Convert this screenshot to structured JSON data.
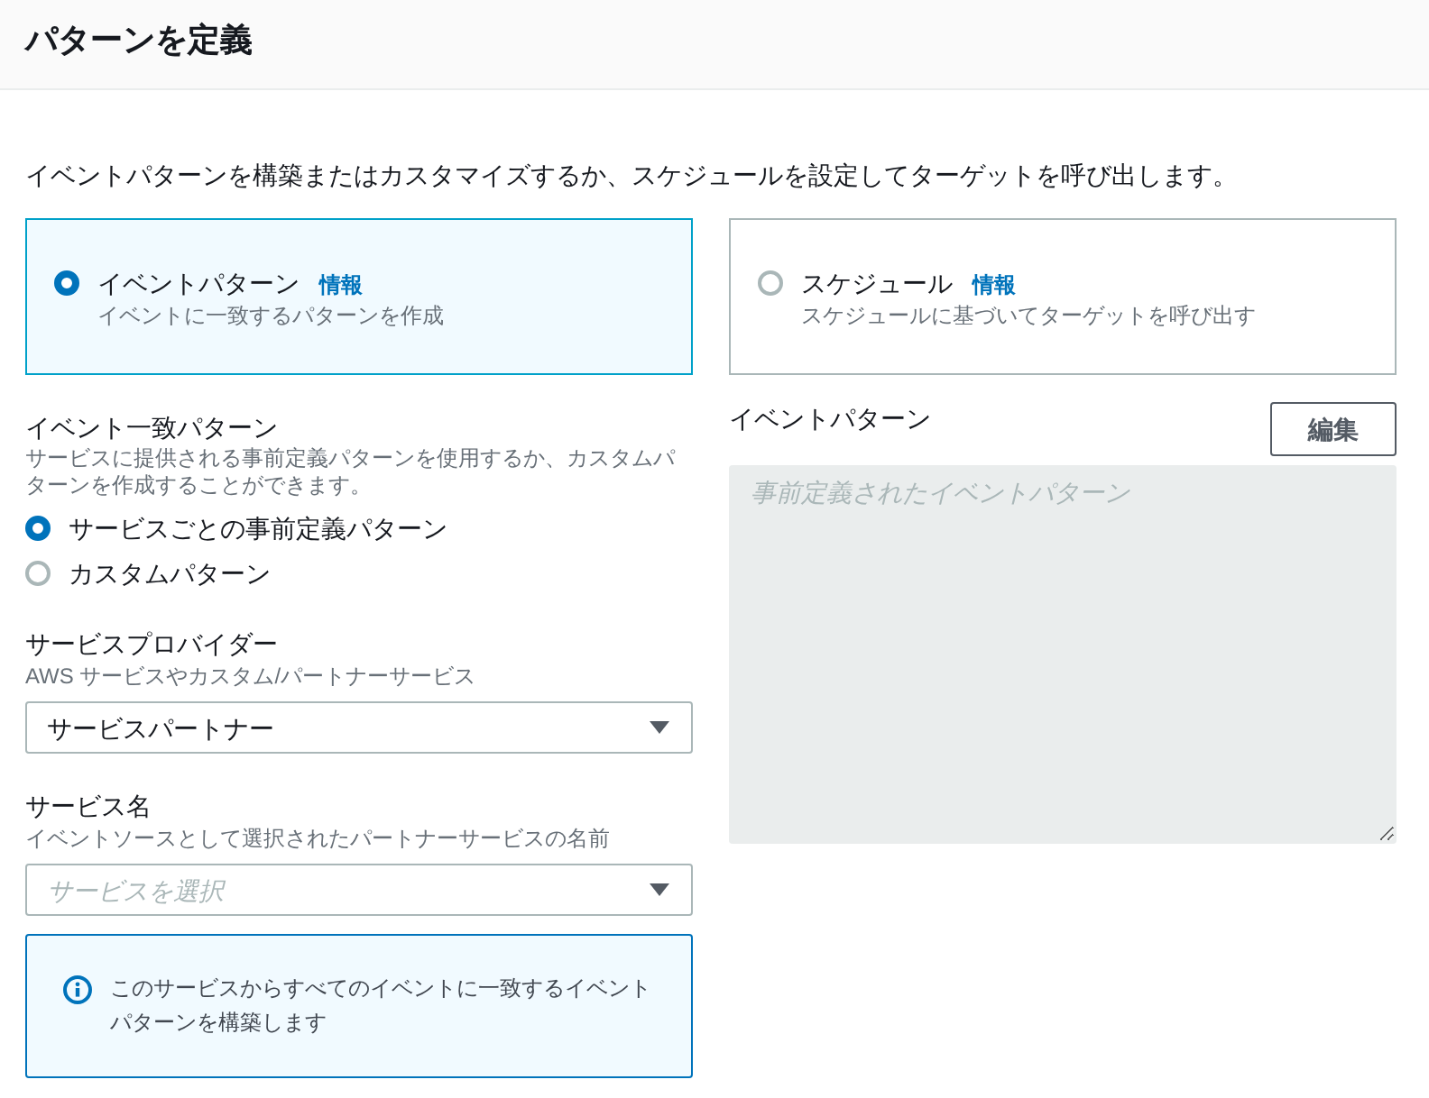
{
  "header": {
    "title": "パターンを定義"
  },
  "intro": "イベントパターンを構築またはカスタマイズするか、スケジュールを設定してターゲットを呼び出します。",
  "pattern_types": [
    {
      "label": "イベントパターン",
      "info_link": "情報",
      "description": "イベントに一致するパターンを作成",
      "selected": true
    },
    {
      "label": "スケジュール",
      "info_link": "情報",
      "description": "スケジュールに基づいてターゲットを呼び出す",
      "selected": false
    }
  ],
  "event_match": {
    "label": "イベント一致パターン",
    "description": "サービスに提供される事前定義パターンを使用するか、カスタムパターンを作成することができます。",
    "options": [
      {
        "label": "サービスごとの事前定義パターン",
        "selected": true
      },
      {
        "label": "カスタムパターン",
        "selected": false
      }
    ]
  },
  "service_provider": {
    "label": "サービスプロバイダー",
    "description": "AWS サービスやカスタム/パートナーサービス",
    "value": "サービスパートナー"
  },
  "service_name": {
    "label": "サービス名",
    "description": "イベントソースとして選択されたパートナーサービスの名前",
    "placeholder": "サービスを選択"
  },
  "info_alert": {
    "text": "このサービスからすべてのイベントに一致するイベントパターンを構築します"
  },
  "event_pattern": {
    "label": "イベントパターン",
    "edit_button": "編集",
    "placeholder": "事前定義されたイベントパターン",
    "disabled": true
  }
}
